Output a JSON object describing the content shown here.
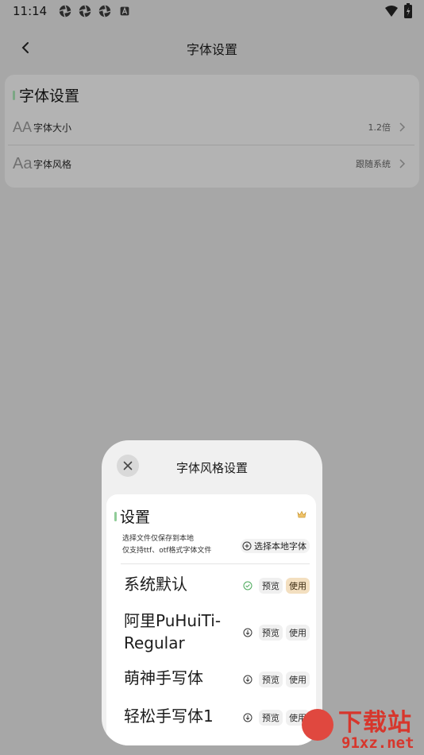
{
  "status_bar": {
    "time": "11:14",
    "icons": [
      "aperture-icon",
      "aperture-icon",
      "aperture-icon",
      "font-a-icon"
    ],
    "right_icons": [
      "wifi-icon",
      "battery-icon"
    ]
  },
  "app_bar": {
    "title": "字体设置"
  },
  "settings_card": {
    "title": "字体设置",
    "rows": [
      {
        "icon_text": "AA",
        "label": "字体大小",
        "value": "1.2倍"
      },
      {
        "icon_text": "Aa",
        "label": "字体风格",
        "value": "跟随系统"
      }
    ]
  },
  "sheet": {
    "title": "字体风格设置",
    "section_title": "设置",
    "note_line1": "选择文件仅保存到本地",
    "note_line2": "仅支持ttf、otf格式字体文件",
    "choose_label": "选择本地字体",
    "preview_label": "预览",
    "use_label": "使用",
    "fonts": [
      {
        "name": "系统默认",
        "status": "selected"
      },
      {
        "name": "阿里PuHuiTi-Regular",
        "status": "download"
      },
      {
        "name": "萌神手写体",
        "status": "download"
      },
      {
        "name": "轻松手写体1",
        "status": "download"
      }
    ]
  },
  "watermark": {
    "top_text": "下载站",
    "bottom_text": "91xz.net"
  },
  "colors": {
    "accent_green": "#7ba784",
    "use_chip_active": "#f3dfc0",
    "watermark_red": "#d7362c"
  }
}
